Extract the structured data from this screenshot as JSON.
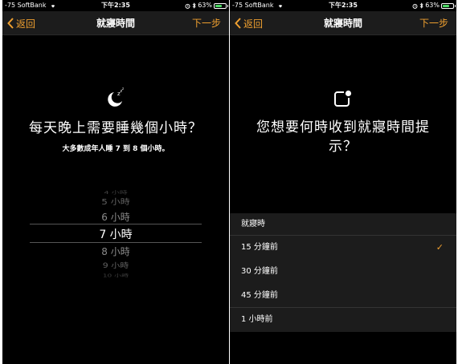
{
  "status_bar": {
    "carrier": "-75 SoftBank",
    "time": "下午2:35",
    "battery_percent": "63%",
    "battery_level": 0.63,
    "icons": [
      "wifi-icon",
      "alarm-icon",
      "bluetooth-icon",
      "battery-icon"
    ]
  },
  "left_screen": {
    "nav": {
      "back_label": "返回",
      "title": "就寢時間",
      "next_label": "下一步"
    },
    "icon": "sleep-moon-icon",
    "heading": "每天晚上需要睡幾個小時？",
    "subheading": "大多數成年人睡 7 到 8 個小時。",
    "picker": {
      "items": [
        "4 小時",
        "5 小時",
        "6 小時",
        "7 小時",
        "8 小時",
        "9 小時",
        "10 小時"
      ],
      "selected": "7 小時"
    }
  },
  "right_screen": {
    "nav": {
      "back_label": "返回",
      "title": "就寢時間",
      "next_label": "下一步"
    },
    "icon": "notification-icon",
    "heading": "您想要何時收到就寢時間提示？",
    "options": {
      "header": "就寢時",
      "items": [
        {
          "label": "15 分鐘前",
          "checked": true
        },
        {
          "label": "30 分鐘前",
          "checked": false
        },
        {
          "label": "45 分鐘前",
          "checked": false
        },
        {
          "label": "1 小時前",
          "checked": false
        }
      ],
      "check_mark": "✓"
    }
  },
  "colors": {
    "accent": "#f0a030",
    "background": "#000000",
    "nav_bar": "#1c1c1c"
  }
}
